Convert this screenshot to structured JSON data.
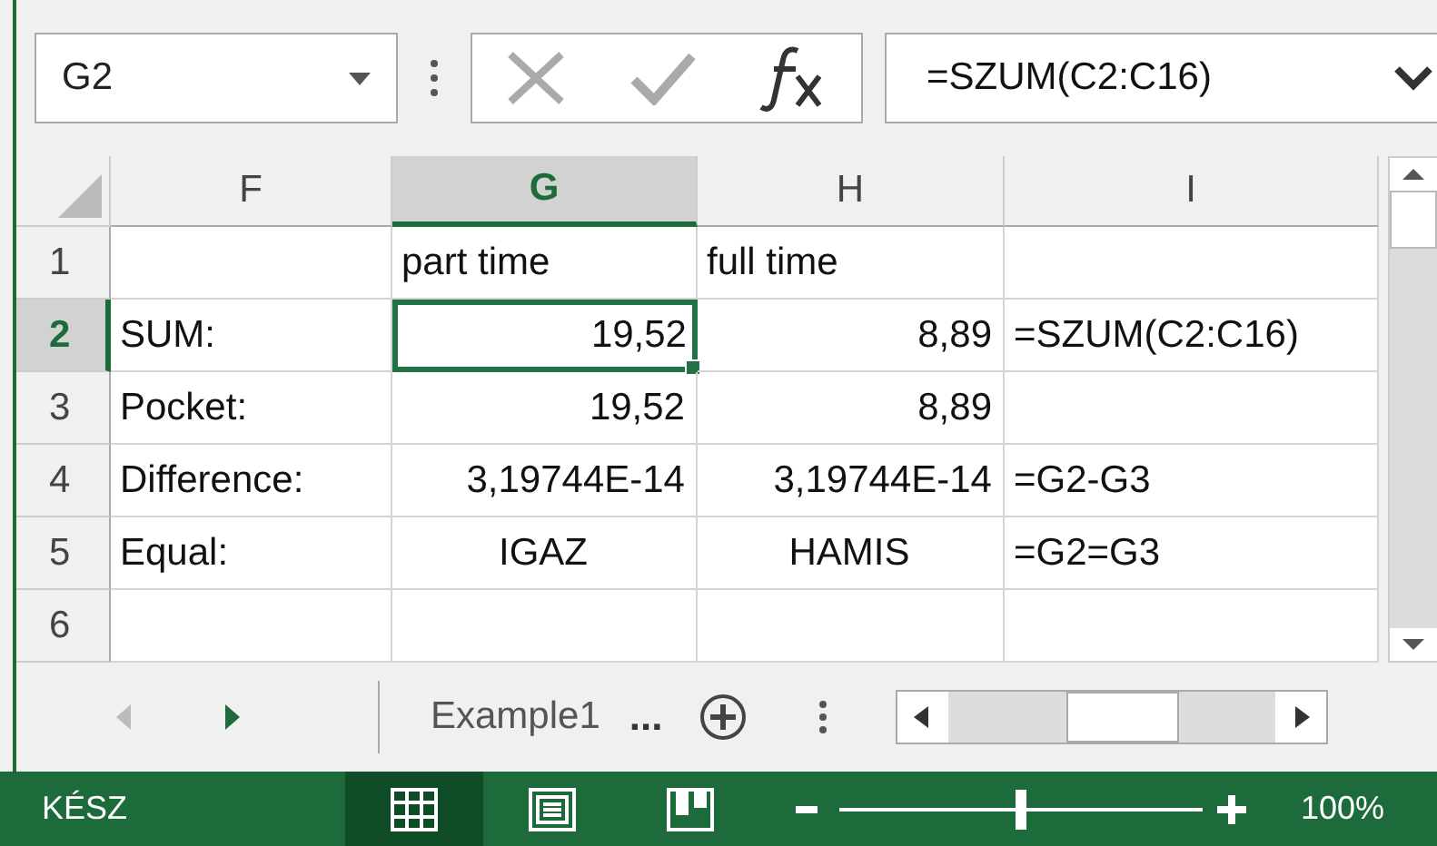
{
  "name_box": {
    "value": "G2"
  },
  "formula_bar": {
    "value": "=SZUM(C2:C16)"
  },
  "columns": [
    {
      "label": "F",
      "selected": false
    },
    {
      "label": "G",
      "selected": true
    },
    {
      "label": "H",
      "selected": false
    },
    {
      "label": "I",
      "selected": false
    }
  ],
  "rows": [
    {
      "label": "1",
      "selected": false,
      "cells": [
        {
          "kind": "empty",
          "active": false
        },
        {
          "kind": "text",
          "text": "part time",
          "active": false
        },
        {
          "kind": "text",
          "text": "full time",
          "active": false
        },
        {
          "kind": "empty",
          "active": false
        }
      ]
    },
    {
      "label": "2",
      "selected": true,
      "cells": [
        {
          "kind": "text",
          "text": "SUM:",
          "active": false
        },
        {
          "kind": "number",
          "text": "19,52",
          "active": true
        },
        {
          "kind": "number",
          "text": "8,89",
          "active": false
        },
        {
          "kind": "text",
          "text": "=SZUM(C2:C16)",
          "active": false
        }
      ]
    },
    {
      "label": "3",
      "selected": false,
      "cells": [
        {
          "kind": "text",
          "text": "Pocket:",
          "active": false
        },
        {
          "kind": "number",
          "text": "19,52",
          "active": false
        },
        {
          "kind": "number",
          "text": "8,89",
          "active": false
        },
        {
          "kind": "empty",
          "active": false
        }
      ]
    },
    {
      "label": "4",
      "selected": false,
      "cells": [
        {
          "kind": "text",
          "text": "Difference:",
          "active": false
        },
        {
          "kind": "number",
          "text": "3,19744E-14",
          "active": false
        },
        {
          "kind": "number",
          "text": "3,19744E-14",
          "active": false
        },
        {
          "kind": "text",
          "text": "=G2-G3",
          "active": false
        }
      ]
    },
    {
      "label": "5",
      "selected": false,
      "cells": [
        {
          "kind": "text",
          "text": "Equal:",
          "active": false
        },
        {
          "kind": "bool",
          "text": "IGAZ",
          "active": false
        },
        {
          "kind": "bool",
          "text": "HAMIS",
          "active": false
        },
        {
          "kind": "text",
          "text": "=G2=G3",
          "active": false
        }
      ]
    },
    {
      "label": "6",
      "selected": false,
      "cells": [
        {
          "kind": "empty",
          "active": false
        },
        {
          "kind": "empty",
          "active": false
        },
        {
          "kind": "empty",
          "active": false
        },
        {
          "kind": "empty",
          "active": false
        }
      ]
    }
  ],
  "sheet_tabs": [
    {
      "label": "Example1"
    }
  ],
  "sheet_tabs_more": "...",
  "status_bar": {
    "status": "KÉSZ",
    "views": [
      {
        "kind": "normal",
        "selected": true
      },
      {
        "kind": "page-layout",
        "selected": false
      },
      {
        "kind": "page-break",
        "selected": false
      }
    ],
    "zoom": {
      "level": 0.5,
      "reading": "100%"
    }
  }
}
